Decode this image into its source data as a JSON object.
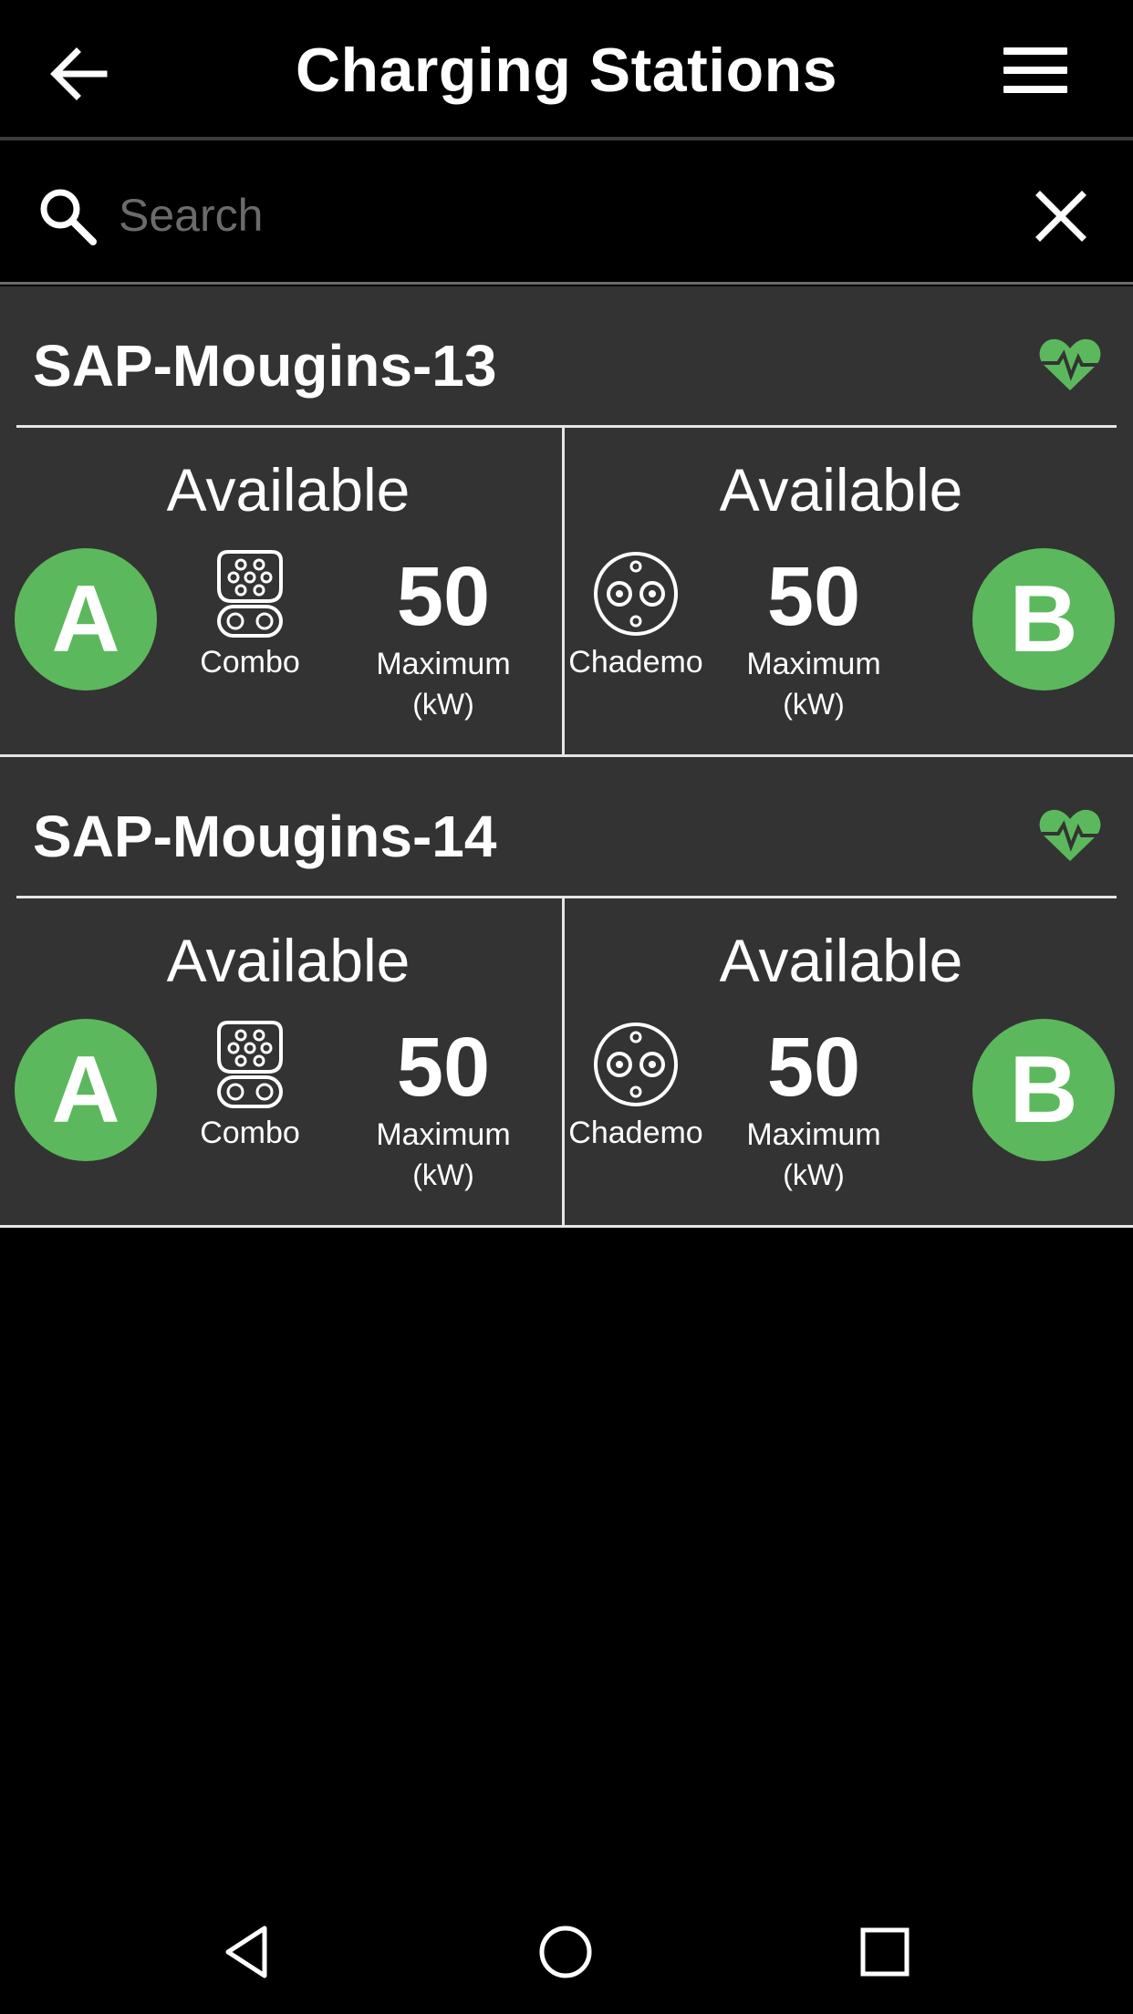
{
  "header": {
    "title": "Charging Stations",
    "back_icon": "arrow-left-icon",
    "menu_icon": "hamburger-menu-icon"
  },
  "search": {
    "placeholder": "Search",
    "value": "",
    "search_icon": "search-icon",
    "clear_icon": "close-icon"
  },
  "colors": {
    "accent_green": "#5cb85c",
    "card_bg": "#333333",
    "page_bg": "#000000"
  },
  "stations": [
    {
      "name": "SAP-Mougins-13",
      "health_icon": "heartbeat-icon",
      "connectors": [
        {
          "id": "A",
          "status": "Available",
          "type": "Combo",
          "power": "50",
          "power_label": "Maximum",
          "power_unit": "(kW)"
        },
        {
          "id": "B",
          "status": "Available",
          "type": "Chademo",
          "power": "50",
          "power_label": "Maximum",
          "power_unit": "(kW)"
        }
      ]
    },
    {
      "name": "SAP-Mougins-14",
      "health_icon": "heartbeat-icon",
      "connectors": [
        {
          "id": "A",
          "status": "Available",
          "type": "Combo",
          "power": "50",
          "power_label": "Maximum",
          "power_unit": "(kW)"
        },
        {
          "id": "B",
          "status": "Available",
          "type": "Chademo",
          "power": "50",
          "power_label": "Maximum",
          "power_unit": "(kW)"
        }
      ]
    }
  ],
  "navbar": {
    "back_icon": "nav-back-triangle-icon",
    "home_icon": "nav-home-circle-icon",
    "recents_icon": "nav-recents-square-icon"
  }
}
